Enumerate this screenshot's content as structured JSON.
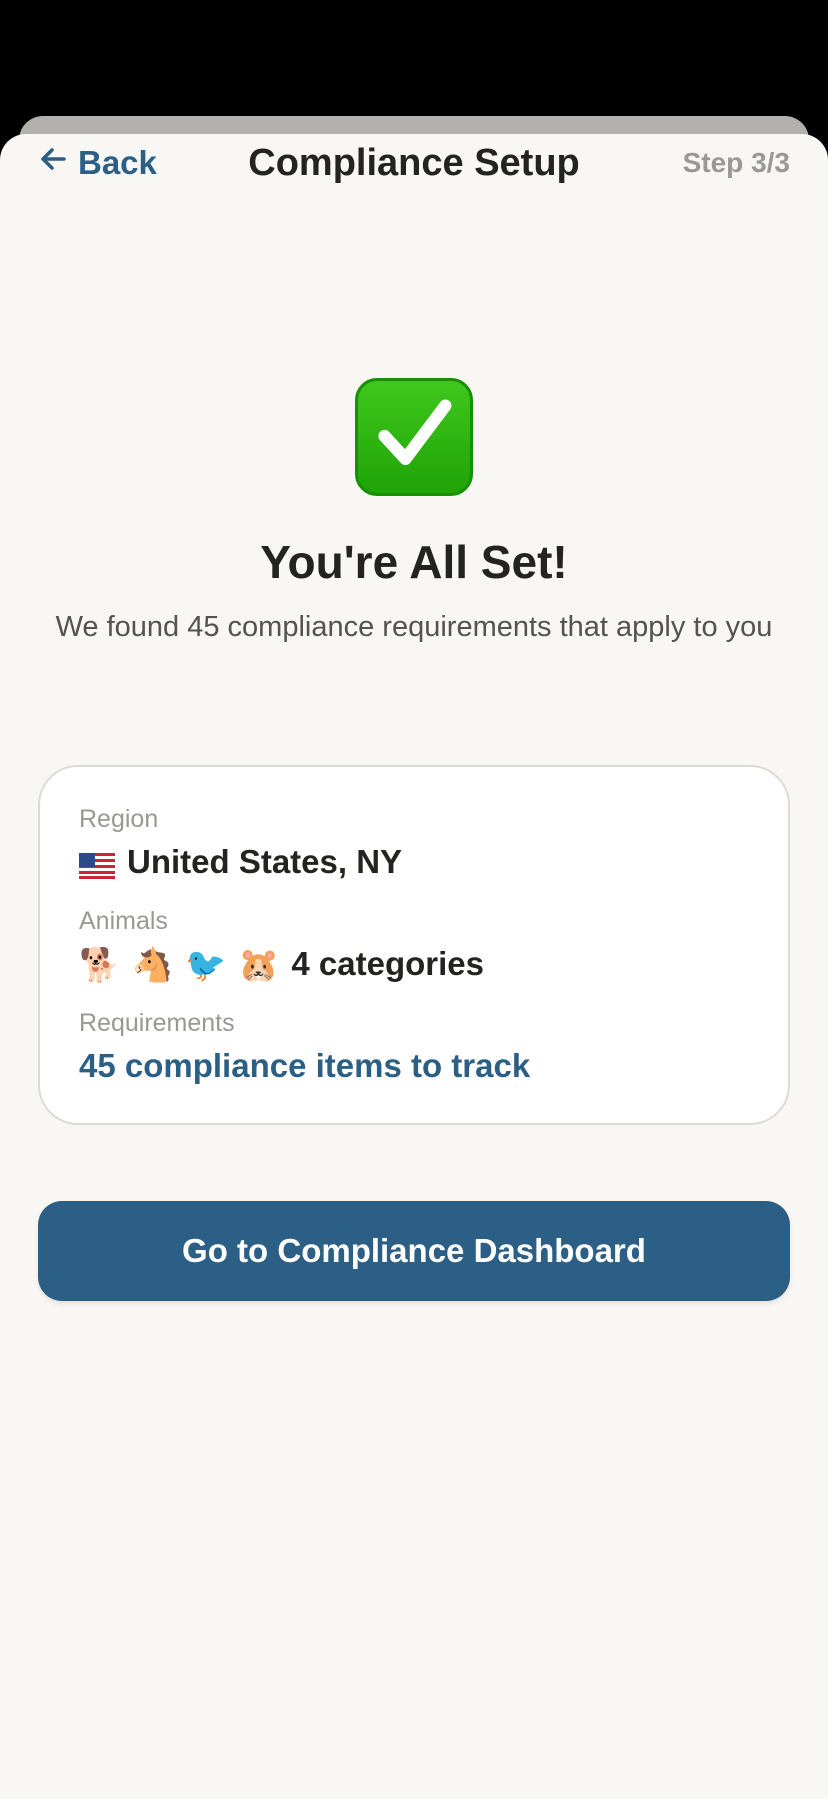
{
  "header": {
    "back_label": "Back",
    "title": "Compliance Setup",
    "step": "Step 3/3"
  },
  "success": {
    "icon": "check-mark-button-icon",
    "heading": "You're All Set!",
    "subtitle": "We found 45 compliance requirements that apply to you"
  },
  "summary": {
    "region_label": "Region",
    "region_flag": "us-flag-icon",
    "region_value": "United States, NY",
    "animals_label": "Animals",
    "animal_icons": [
      "🐕",
      "🐴",
      "🐦",
      "🐹"
    ],
    "animals_value": "4 categories",
    "requirements_label": "Requirements",
    "requirements_value": "45 compliance items to track"
  },
  "cta": {
    "label": "Go to Compliance Dashboard"
  },
  "colors": {
    "accent": "#2c5f85",
    "background": "#f8f7f4",
    "success": "#22a80a"
  }
}
